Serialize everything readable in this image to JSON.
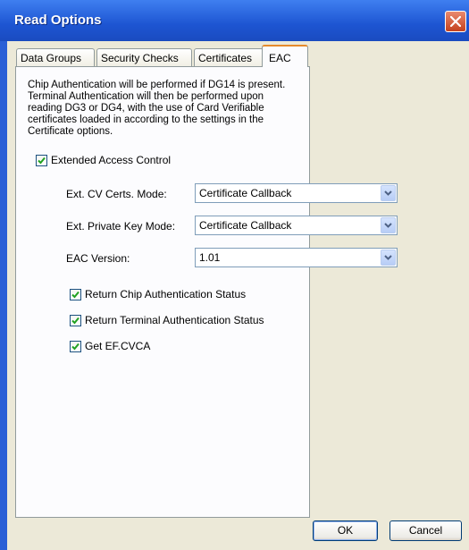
{
  "window": {
    "title": "Read Options"
  },
  "tabs": [
    {
      "label": "Data Groups"
    },
    {
      "label": "Security Checks"
    },
    {
      "label": "Certificates"
    },
    {
      "label": "EAC"
    }
  ],
  "eac": {
    "description": "Chip Authentication will be performed if DG14 is present. Terminal Authentication will then be performed upon reading DG3 or DG4, with the use of Card Verifiable certificates loaded in according to the settings in the Certificate options.",
    "extended_access_control": {
      "label": "Extended Access Control",
      "checked": true
    },
    "cv_certs_mode": {
      "label": "Ext. CV Certs. Mode:",
      "value": "Certificate Callback"
    },
    "private_key_mode": {
      "label": "Ext. Private Key Mode:",
      "value": "Certificate Callback"
    },
    "eac_version": {
      "label": "EAC Version:",
      "value": "1.01"
    },
    "return_chip_auth": {
      "label": "Return Chip Authentication Status",
      "checked": true
    },
    "return_terminal_auth": {
      "label": "Return Terminal Authentication Status",
      "checked": true
    },
    "get_ef_cvca": {
      "label": "Get EF.CVCA",
      "checked": true
    }
  },
  "buttons": {
    "ok": "OK",
    "cancel": "Cancel"
  },
  "colors": {
    "titlebar": "#1d55d2",
    "dialog_face": "#ece9d8",
    "tab_highlight": "#e68b2c",
    "checkmark": "#21a121"
  }
}
